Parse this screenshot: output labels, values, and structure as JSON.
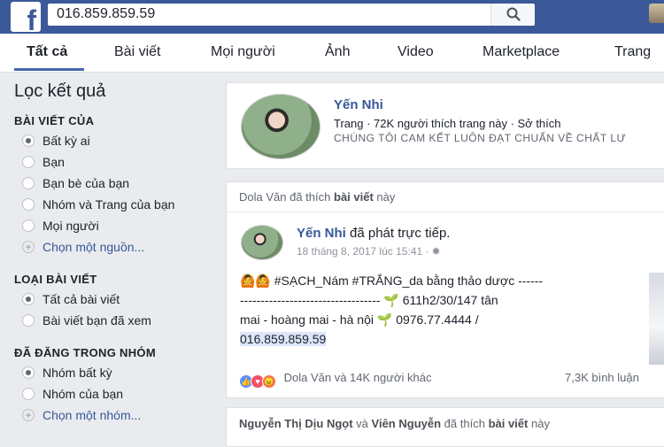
{
  "search": {
    "query": "016.859.859.59"
  },
  "tabs": [
    {
      "label": "Tất cả",
      "active": true
    },
    {
      "label": "Bài viết"
    },
    {
      "label": "Mọi người"
    },
    {
      "label": "Ảnh"
    },
    {
      "label": "Video"
    },
    {
      "label": "Marketplace"
    },
    {
      "label": "Trang"
    }
  ],
  "filters": {
    "title": "Lọc kết quả",
    "groups": [
      {
        "title": "BÀI VIẾT CỦA",
        "options": [
          "Bất kỳ ai",
          "Bạn",
          "Bạn bè của bạn",
          "Nhóm và Trang của bạn",
          "Mọi người"
        ],
        "selected": 0,
        "link": "Chọn một nguồn..."
      },
      {
        "title": "LOẠI BÀI VIẾT",
        "options": [
          "Tất cả bài viết",
          "Bài viết bạn đã xem"
        ],
        "selected": 0
      },
      {
        "title": "ĐÃ ĐĂNG TRONG NHÓM",
        "options": [
          "Nhóm bất kỳ",
          "Nhóm của bạn"
        ],
        "selected": 0,
        "link": "Chọn một nhóm..."
      }
    ]
  },
  "page_result": {
    "name": "Yến Nhi",
    "meta": "Trang · 72K người thích trang này · Sở thích",
    "description": "CHÚNG TÔI CAM KẾT LUÔN ĐẠT CHUẨN VỀ CHẤT LƯ"
  },
  "post": {
    "liked_by": "Dola Văn",
    "liked_text": "đã thích",
    "liked_object": "bài viết",
    "liked_suffix": "này",
    "author": "Yến Nhi",
    "action": "đã phát trực tiếp.",
    "time": "18 tháng 8, 2017 lúc 15:41 ·",
    "text_line1": "#SẠCH_Nám #TRẮNG_da bằng thảo dược ------",
    "text_line2": "----------------------------------",
    "text_line2b": "611h2/30/147 tân",
    "text_line3": "mai - hoàng mai - hà nội",
    "text_line3b": "0976.77.4444 /",
    "text_highlight": "016.859.859.59",
    "reactions_text": "Dola Văn và 14K người khác",
    "comments": "7,3K bình luận"
  },
  "next_post": {
    "liker1": "Nguyễn Thị Dịu Ngọt",
    "and": "và",
    "liker2": "Viên Nguyễn",
    "liked_text": "đã thích",
    "liked_object": "bài viết",
    "liked_suffix": "này"
  },
  "colors": {
    "brand": "#3b5998",
    "link": "#365899",
    "tab_underline": "#4267b2"
  }
}
